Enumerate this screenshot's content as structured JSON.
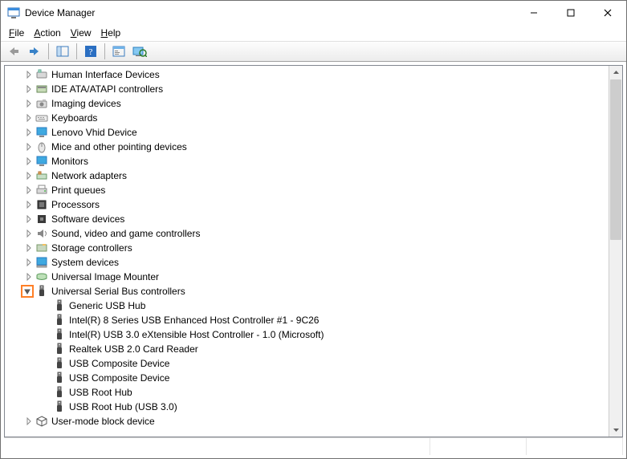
{
  "window": {
    "title": "Device Manager"
  },
  "menu": {
    "file": "File",
    "action": "Action",
    "view": "View",
    "help": "Help"
  },
  "toolbar": {
    "back": "Back",
    "forward": "Forward",
    "detail": "Show/Hide Console Tree",
    "help": "Help",
    "props": "Properties",
    "scan": "Scan for hardware changes"
  },
  "tree": {
    "top": [
      {
        "label": "Human Interface Devices",
        "icon": "hid"
      },
      {
        "label": "IDE ATA/ATAPI controllers",
        "icon": "ide"
      },
      {
        "label": "Imaging devices",
        "icon": "camera"
      },
      {
        "label": "Keyboards",
        "icon": "keyboard"
      },
      {
        "label": "Lenovo Vhid Device",
        "icon": "monitor"
      },
      {
        "label": "Mice and other pointing devices",
        "icon": "mouse"
      },
      {
        "label": "Monitors",
        "icon": "monitor"
      },
      {
        "label": "Network adapters",
        "icon": "network"
      },
      {
        "label": "Print queues",
        "icon": "printer"
      },
      {
        "label": "Processors",
        "icon": "cpu"
      },
      {
        "label": "Software devices",
        "icon": "software"
      },
      {
        "label": "Sound, video and game controllers",
        "icon": "sound"
      },
      {
        "label": "Storage controllers",
        "icon": "storage"
      },
      {
        "label": "System devices",
        "icon": "system"
      },
      {
        "label": "Universal Image Mounter",
        "icon": "uim"
      }
    ],
    "usb": {
      "label": "Universal Serial Bus controllers",
      "children": [
        "Generic USB Hub",
        "Intel(R) 8 Series USB Enhanced Host Controller #1 - 9C26",
        "Intel(R) USB 3.0 eXtensible Host Controller - 1.0 (Microsoft)",
        "Realtek USB 2.0 Card Reader",
        "USB Composite Device",
        "USB Composite Device",
        "USB Root Hub",
        "USB Root Hub (USB 3.0)"
      ]
    },
    "bottom": [
      {
        "label": "User-mode block device",
        "icon": "block"
      }
    ]
  }
}
